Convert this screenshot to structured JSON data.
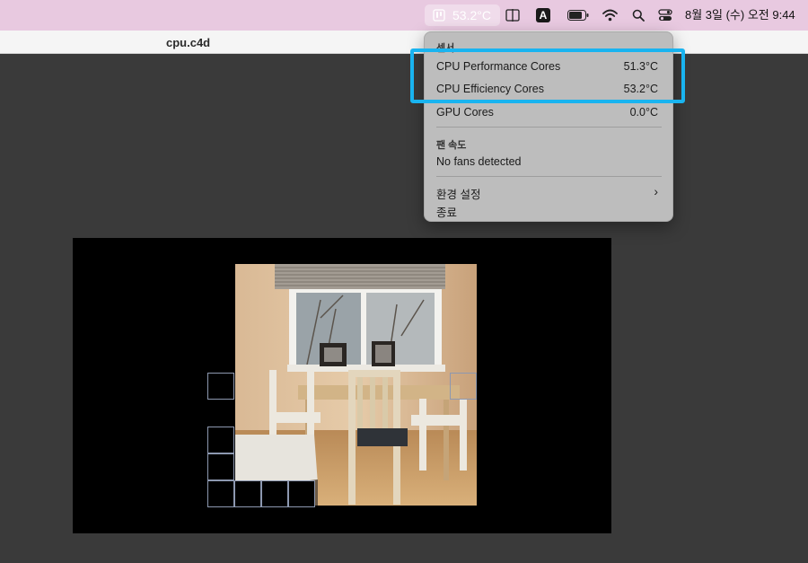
{
  "menubar": {
    "temperature": "53.2°C",
    "keyboard_input": "A",
    "clock": "8월 3일 (수) 오전  9:44",
    "icons": [
      "thermometer-icon",
      "split-view-icon",
      "input-source-icon",
      "battery-icon",
      "wifi-icon",
      "search-icon",
      "control-center-icon"
    ]
  },
  "window": {
    "title": "cpu.c4d"
  },
  "menu": {
    "sensors_header": "센서",
    "sensors": [
      {
        "label": "CPU Performance Cores",
        "value": "51.3°C"
      },
      {
        "label": "CPU Efficiency Cores",
        "value": "53.2°C"
      },
      {
        "label": "GPU Cores",
        "value": "0.0°C"
      }
    ],
    "fans_header": "팬 속도",
    "fans_status": "No fans detected",
    "preferences": "환경 설정",
    "quit": "종료"
  },
  "colors": {
    "highlight": "#19b4f0",
    "menubar": "#e8c9e0"
  }
}
